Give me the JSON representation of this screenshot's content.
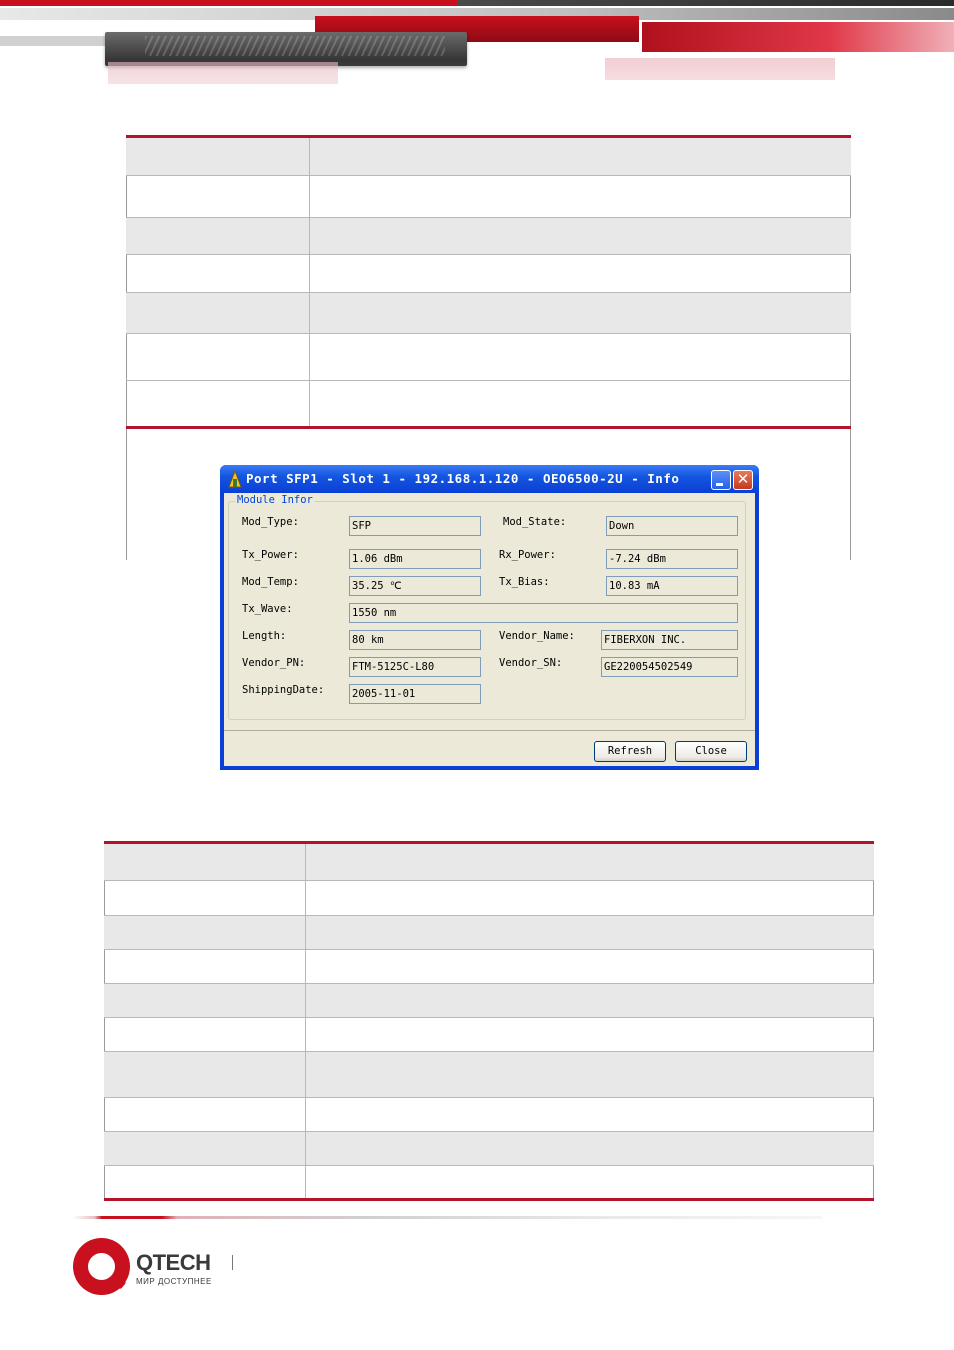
{
  "dialog": {
    "title": "Port SFP1 - Slot 1 - 192.168.1.120 - OEO6500-2U - Info",
    "group_label": "Module Infor",
    "fields": {
      "mod_type": {
        "label": "Mod_Type:",
        "value": "SFP"
      },
      "mod_state": {
        "label": "Mod_State:",
        "value": "Down"
      },
      "tx_power": {
        "label": "Tx_Power:",
        "value": "1.06 dBm"
      },
      "rx_power": {
        "label": "Rx_Power:",
        "value": "-7.24 dBm"
      },
      "mod_temp": {
        "label": "Mod_Temp:",
        "value": "35.25 ℃"
      },
      "tx_bias": {
        "label": "Tx_Bias:",
        "value": "10.83 mA"
      },
      "tx_wave": {
        "label": "Tx_Wave:",
        "value": "1550 nm"
      },
      "length": {
        "label": "Length:",
        "value": "80 km"
      },
      "vendor_name": {
        "label": "Vendor_Name:",
        "value": "FIBERXON INC."
      },
      "vendor_pn": {
        "label": "Vendor_PN:",
        "value": "FTM-5125C-L80"
      },
      "vendor_sn": {
        "label": "Vendor_SN:",
        "value": "GE220054502549"
      },
      "shipping_date": {
        "label": "ShippingDate:",
        "value": "2005-11-01"
      }
    },
    "buttons": {
      "refresh": "Refresh",
      "close": "Close",
      "close_glyph": "✕"
    }
  },
  "footer": {
    "brand": "QTECH",
    "tagline": "МИР ДОСТУПНЕЕ"
  },
  "colors": {
    "accent": "#b3132b",
    "brand_red": "#c8101e",
    "xp_blue": "#0a3fd6",
    "dialog_bg": "#ece9d8"
  }
}
